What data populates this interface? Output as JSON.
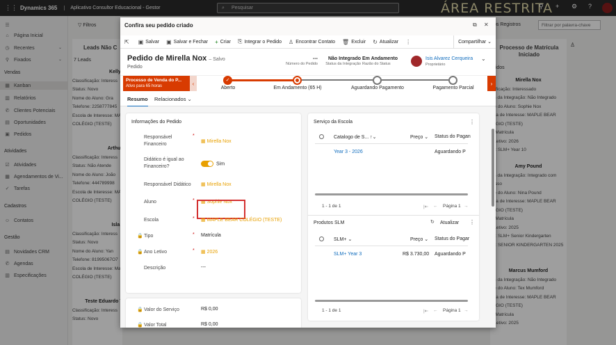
{
  "topbar": {
    "brand": "Dynamics 365",
    "app_name": "Aplicativo Consultor Educacional - Gestor",
    "search_placeholder": "Pesquisar",
    "restricted_label": "ÁREA RESTRITA"
  },
  "nav": {
    "items": [
      {
        "label": "Página Inicial",
        "icon": "home-icon"
      },
      {
        "label": "Recentes",
        "icon": "clock-icon"
      },
      {
        "label": "Fixados",
        "icon": "pin-icon"
      }
    ],
    "group_vendas": "Vendas",
    "vendas_items": [
      "Kanban",
      "Relatórios",
      "Clientes Potenciais",
      "Oportunidades",
      "Pedidos"
    ],
    "group_atividades": "Atividades",
    "atividades_items": [
      "Atividades",
      "Agendamentos de Vi...",
      "Tarefas"
    ],
    "group_cadastros": "Cadastros",
    "cadastros_items": [
      "Contatos"
    ],
    "group_gestao": "Gestão",
    "gestao_items": [
      "Novidades CRM",
      "Agendas",
      "Especificações"
    ]
  },
  "board": {
    "filters_label": "Filtros",
    "lane1_title": "Leads Não C",
    "lane1_count": "7 Leads",
    "lane1_cards": [
      {
        "name": "Kelly F",
        "lines": [
          "Classificação: Interess",
          "Status: Novo",
          "Nome do Aluno: Gra",
          "Telefone: 2258777845",
          "Escola de Interesse: MA",
          "COLÉGIO (TESTE)"
        ]
      },
      {
        "name": "Arthur I",
        "lines": [
          "Classificação: Interess",
          "Status: Não Atende",
          "Nome do Aluno: João",
          "Telefone: 444789998",
          "Escola de Interesse: MA",
          "COLÉGIO (TESTE)"
        ]
      },
      {
        "name": "Isla M",
        "lines": [
          "Classificação: Interess",
          "Status: Novo",
          "Nome do Aluno: Yan",
          "Telefone: 81995067O7",
          "Escola de Interesse: Ma",
          "COLÉGIO (TESTE)"
        ]
      },
      {
        "name": "Teste Eduardo Te",
        "lines": [
          "Classificação: Interess",
          "Status: Novo"
        ]
      }
    ],
    "records_label": "os Registros",
    "keyword_placeholder": "Filtrar por palavra-chave",
    "lane2_title": "Processo de Matrícula Iniciado",
    "lane2_count": "edidos",
    "lane2_cards": [
      {
        "name": "Mirella Nox",
        "lines": [
          "ssificação: Interessado",
          "tus da Integração: Não Integrado",
          "me do Aluno: Sophie Nox",
          "cola de Interesse: MAPLE BEAR",
          "LÉGIO (TESTE)",
          "o: Matrícula",
          "o Letivo: 2026",
          "rie: SLM+ Year 10"
        ]
      },
      {
        "name": "Amy Pound",
        "lines": [
          "tus da Integração: Integrado com",
          "cesso",
          "me do Aluno: Nina Pound",
          "cola de Interesse: MAPLE BEAR",
          "LÉGIO (TESTE)",
          "o: Matrícula",
          "o Letivo: 2025",
          "rie: SLM+ Senior Kindergarten",
          "rie: SENIOR KINDERGARTEN 2025"
        ]
      },
      {
        "name": "Marcus Mumford",
        "lines": [
          "tus da Integração: Não Integrado",
          "me do Aluno: Tex Mumford",
          "cola de Interesse: MAPLE BEAR",
          "LÉGIO (TESTE)",
          "o: Matrícula",
          "o Letivo: 2025"
        ]
      }
    ]
  },
  "modal": {
    "title": "Confira seu pedido criado",
    "commands": [
      {
        "label": "Salvar",
        "icon": "save-icon"
      },
      {
        "label": "Salvar e Fechar",
        "icon": "save-close-icon"
      },
      {
        "label": "Criar",
        "icon": "plus-icon"
      },
      {
        "label": "Integrar o Pedido",
        "icon": "integrate-icon"
      },
      {
        "label": "Encontrar Contato",
        "icon": "find-contact-icon"
      },
      {
        "label": "Excluir",
        "icon": "trash-icon"
      },
      {
        "label": "Atualizar",
        "icon": "refresh-icon"
      }
    ],
    "share_label": "Compartilhar",
    "record_title": "Pedido de Mirella Nox",
    "saved_status": "– Salvo",
    "entity_type": "Pedido",
    "header_fields": [
      {
        "value": "---",
        "label": "Número do Pedido"
      },
      {
        "value": "Não Integrado",
        "label": "Status da Integração"
      },
      {
        "value": "Em Andamento",
        "label": "Razão do Status"
      }
    ],
    "owner_name": "Isis Alvarez Cerqueira",
    "owner_label": "Proprietário",
    "bpf": {
      "active_name": "Processo de Venda do P...",
      "active_sub": "Ativo para 65 horas",
      "stages": [
        "Aberto",
        "Em Andamento  (65 H)",
        "Aguardando Pagamento",
        "Pagamento Parcial"
      ]
    },
    "tabs": [
      "Resumo",
      "Relacionados"
    ],
    "info_section": {
      "title": "Informações do Pedido",
      "fields": [
        {
          "label": "Responsável Financeiro",
          "value": "Mirella Nox"
        },
        {
          "label": "Didático é igual ao Financeiro?",
          "value": "Sim"
        },
        {
          "label": "Responsável Didático",
          "value": "Mirella Nox"
        },
        {
          "label": "Aluno",
          "value": "Sophie Nox"
        },
        {
          "label": "Escola",
          "value": "MAPLE BEAR COLÉGIO (TESTE)"
        },
        {
          "label": "Tipo",
          "value": "Matrícula"
        },
        {
          "label": "Ano Letivo",
          "value": "2026"
        },
        {
          "label": "Descrição",
          "value": "---"
        }
      ]
    },
    "values_section": {
      "fields": [
        {
          "label": "Valor do Serviço",
          "value": "R$ 0,00"
        },
        {
          "label": "Valor Total",
          "value": "R$ 0,00"
        }
      ]
    },
    "school_service": {
      "title": "Serviço da Escola",
      "columns": [
        "Catalogo de S...",
        "Preço",
        "Status do Pagan"
      ],
      "rows": [
        {
          "name": "Year 3 - 2026",
          "price": "",
          "status": "Aguardando P"
        }
      ],
      "range": "1 - 1 de 1",
      "page": "Página 1"
    },
    "slm_products": {
      "title": "Produtos SLM",
      "refresh_label": "Atualizar",
      "columns": [
        "SLM+",
        "Preço",
        "Status do Pagar"
      ],
      "rows": [
        {
          "name": "SLM+ Year 3",
          "price": "R$ 3.730,00",
          "status": "Aguardando P"
        }
      ],
      "range": "1 - 1 de 1",
      "page": "Página 1"
    }
  }
}
